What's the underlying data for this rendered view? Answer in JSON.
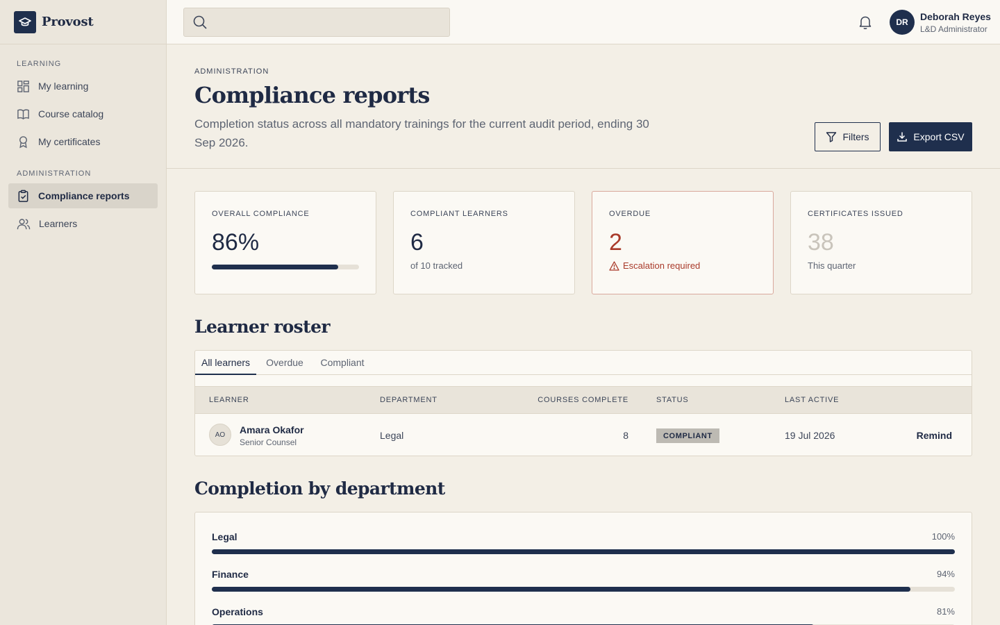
{
  "app": {
    "name": "Provost"
  },
  "sidebar": {
    "sections": [
      {
        "heading": "LEARNING",
        "items": [
          {
            "label": "My learning",
            "icon": "dashboard-icon"
          },
          {
            "label": "Course catalog",
            "icon": "book-icon"
          },
          {
            "label": "My certificates",
            "icon": "award-icon"
          }
        ]
      },
      {
        "heading": "ADMINISTRATION",
        "items": [
          {
            "label": "Compliance reports",
            "icon": "clipboard-check-icon",
            "active": true
          },
          {
            "label": "Learners",
            "icon": "users-icon"
          }
        ]
      }
    ]
  },
  "topbar": {
    "search": {
      "placeholder": "",
      "value": ""
    },
    "user": {
      "initials": "DR",
      "name": "Deborah Reyes",
      "role": "L&D Administrator"
    }
  },
  "header": {
    "eyebrow": "ADMINISTRATION",
    "title": "Compliance reports",
    "description": "Completion status across all mandatory trainings for the current audit period, ending 30 Sep 2026.",
    "filters_label": "Filters",
    "export_label": "Export CSV"
  },
  "stats": {
    "overall": {
      "label": "OVERALL COMPLIANCE",
      "value": "86%",
      "progress": 0.86
    },
    "compliant": {
      "label": "COMPLIANT LEARNERS",
      "value": "6",
      "sub": "of 10 tracked"
    },
    "overdue": {
      "label": "OVERDUE",
      "value": "2",
      "sub": "Escalation required"
    },
    "certificates": {
      "label": "CERTIFICATES ISSUED",
      "value": "38",
      "sub": "This quarter"
    }
  },
  "roster": {
    "title": "Learner roster",
    "tabs": [
      {
        "label": "All learners",
        "active": true
      },
      {
        "label": "Overdue"
      },
      {
        "label": "Compliant"
      }
    ],
    "columns": [
      "LEARNER",
      "DEPARTMENT",
      "COURSES COMPLETE",
      "STATUS",
      "LAST ACTIVE"
    ],
    "rows": [
      {
        "initials": "AO",
        "name": "Amara Okafor",
        "title": "Senior Counsel",
        "department": "Legal",
        "courses": "8",
        "status": "COMPLIANT",
        "last_active": "19 Jul 2026",
        "action": "Remind"
      }
    ]
  },
  "departments": {
    "title": "Completion by department",
    "items": [
      {
        "name": "Legal",
        "pct_label": "100%",
        "value": 1.0
      },
      {
        "name": "Finance",
        "pct_label": "94%",
        "value": 0.94
      },
      {
        "name": "Operations",
        "pct_label": "81%",
        "value": 0.81
      }
    ]
  },
  "colors": {
    "navy": "#1f2f4d",
    "alert": "#a93a2a",
    "background": "#f3efe6"
  }
}
